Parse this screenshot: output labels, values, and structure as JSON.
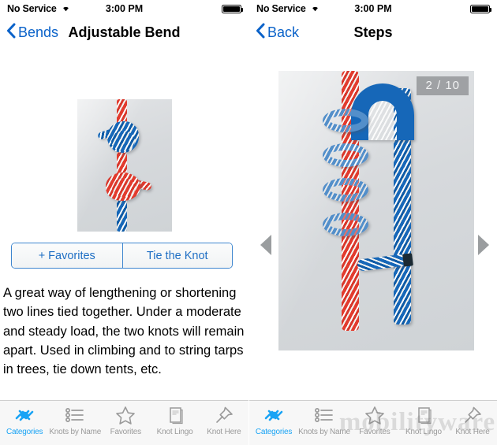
{
  "left": {
    "status": {
      "carrier": "No Service",
      "time": "3:00 PM",
      "wifi_icon": "wifi-icon",
      "battery_icon": "battery-full-icon"
    },
    "nav": {
      "back_label": "Bends",
      "back_icon": "chevron-left-icon",
      "title": "Adjustable Bend"
    },
    "photo": {
      "name": "adjustable-bend-knot-photo"
    },
    "segmented": {
      "favorites_label": "+ Favorites",
      "tie_label": "Tie the Knot"
    },
    "description": "A great way of lengthening or shortening two lines tied together. Under a moderate and steady load, the two knots will remain apart. Used in climbing and to string tarps in trees, tie down tents, etc."
  },
  "right": {
    "status": {
      "carrier": "No Service",
      "time": "3:00 PM",
      "wifi_icon": "wifi-icon",
      "battery_icon": "battery-full-icon"
    },
    "nav": {
      "back_label": "Back",
      "back_icon": "chevron-left-icon",
      "title": "Steps"
    },
    "photo": {
      "name": "knot-step-photo"
    },
    "step_badge": "2 / 10",
    "prev_icon": "triangle-left-icon",
    "next_icon": "triangle-right-icon",
    "watermark": "mobilityware"
  },
  "tabs": [
    {
      "label": "Categories",
      "icon": "knot-icon",
      "active": true
    },
    {
      "label": "Knots by Name",
      "icon": "list-icon",
      "active": false
    },
    {
      "label": "Favorites",
      "icon": "star-icon",
      "active": false
    },
    {
      "label": "Knot Lingo",
      "icon": "book-icon",
      "active": false
    },
    {
      "label": "Knot Here",
      "icon": "pushpin-icon",
      "active": false
    }
  ],
  "colors": {
    "accent_blue": "#0a62c9",
    "tab_active": "#18a3f5",
    "tab_inactive": "#9a9a9a",
    "badge_bg": "#919496",
    "rope_red": "#e23b2e",
    "rope_blue": "#1667b8"
  }
}
